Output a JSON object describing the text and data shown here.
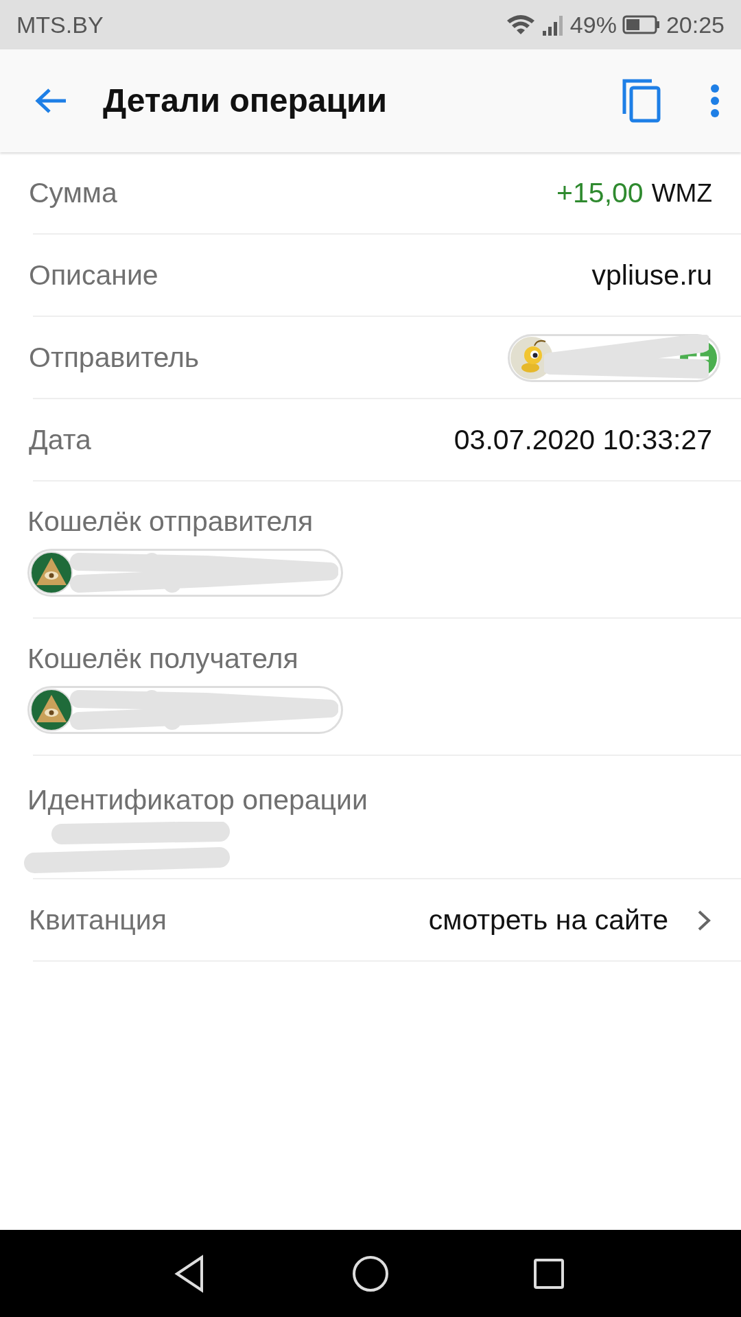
{
  "status_bar": {
    "carrier": "MTS.BY",
    "battery": "49%",
    "time": "20:25"
  },
  "toolbar": {
    "title": "Детали операции"
  },
  "rows": [
    {
      "kind": "amount",
      "label": "Сумма",
      "value": "+15,00",
      "currency": "WMZ"
    },
    {
      "kind": "text",
      "label": "Описание",
      "value": "vpliuse.ru"
    },
    {
      "kind": "sender",
      "label": "Отправитель"
    },
    {
      "kind": "text",
      "label": "Дата",
      "value": "03.07.2020 10:33:27"
    },
    {
      "kind": "wallet",
      "label": "Кошелёк отправителя"
    },
    {
      "kind": "wallet",
      "label": "Кошелёк получателя"
    },
    {
      "kind": "id",
      "label": "Идентификатор операции"
    },
    {
      "kind": "link",
      "label": "Квитанция",
      "value": "смотреть на сайте"
    }
  ]
}
